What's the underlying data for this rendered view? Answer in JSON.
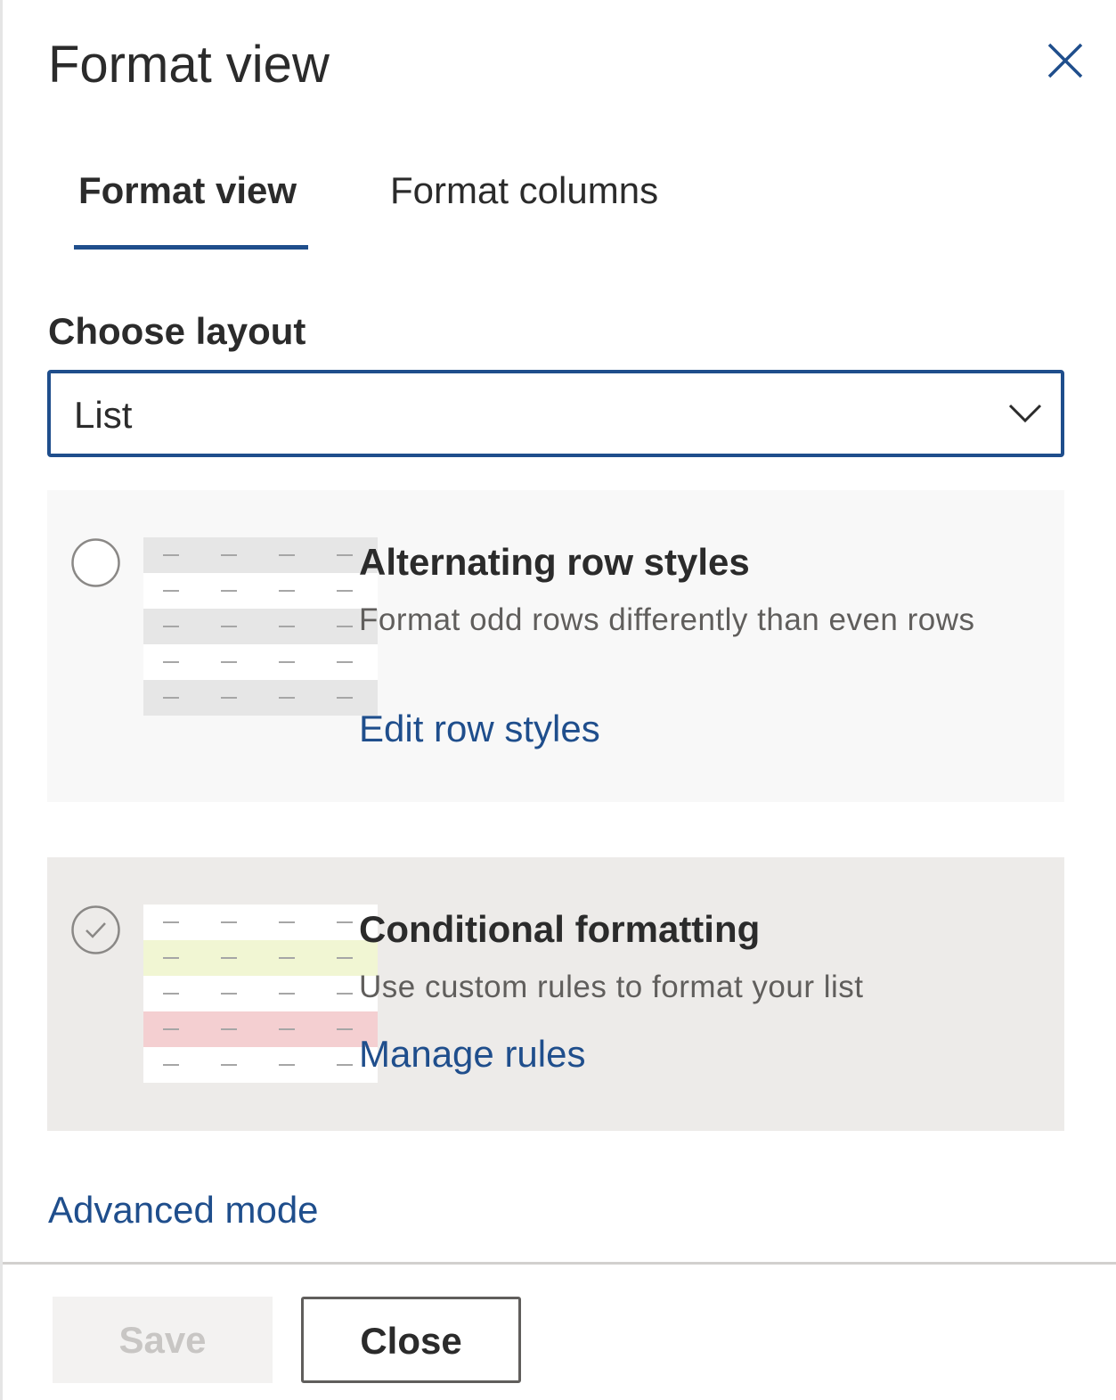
{
  "panel": {
    "title": "Format view",
    "close_icon": "close-icon"
  },
  "tabs": [
    {
      "label": "Format view",
      "selected": true
    },
    {
      "label": "Format columns",
      "selected": false
    }
  ],
  "layout": {
    "label": "Choose layout",
    "selected_value": "List",
    "chevron_icon": "chevron-down-icon"
  },
  "options": [
    {
      "title": "Alternating row styles",
      "description": "Format odd rows differently than even rows",
      "link": "Edit row styles",
      "selected": false,
      "preview_rows": [
        "#e6e6e6",
        "#ffffff",
        "#e6e6e6",
        "#ffffff",
        "#e6e6e6"
      ]
    },
    {
      "title": "Conditional formatting",
      "description": "Use custom rules to format your list",
      "link": "Manage rules",
      "selected": true,
      "preview_rows": [
        "#ffffff",
        "#f1f6d3",
        "#ffffff",
        "#f4cfd1",
        "#ffffff"
      ]
    }
  ],
  "advanced_link": "Advanced mode",
  "footer": {
    "save_label": "Save",
    "save_disabled": true,
    "close_label": "Close"
  },
  "colors": {
    "accent": "#1f4e8c",
    "text": "#2b2b2b",
    "muted_text": "#605e5c"
  }
}
